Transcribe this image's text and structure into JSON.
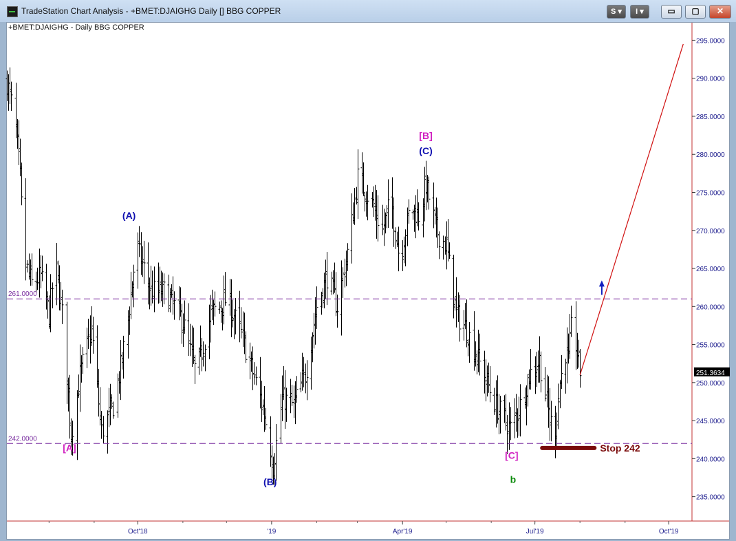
{
  "window": {
    "title": "TradeStation Chart Analysis - +BMET:DJAIGHG Daily [] BBG COPPER",
    "buttons": {
      "s_label": "S",
      "i_label": "I",
      "minimize": "▭",
      "maximize": "▢",
      "close": "✕"
    }
  },
  "colors": {
    "bars": "#000000",
    "level_line": "#7a2fa0",
    "projection": "#d01010",
    "stop_bar": "#7a0a0a",
    "label_blue": "#1010b0",
    "label_magenta": "#d020c0",
    "label_green": "#0a8a0a",
    "arrow": "#1020c0"
  },
  "chart_data": {
    "type": "ohlc",
    "symbol_label": "+BMET:DJAIGHG - Daily  BBG COPPER",
    "y_ticks": [
      "295.0000",
      "290.0000",
      "285.0000",
      "280.0000",
      "275.0000",
      "270.0000",
      "265.0000",
      "260.0000",
      "255.0000",
      "250.0000",
      "245.0000",
      "240.0000",
      "235.0000"
    ],
    "ylim": [
      231.8,
      297.3
    ],
    "x_ticks": [
      {
        "label": "Oct'18",
        "date": "2018-10-01"
      },
      {
        "label": "'19",
        "date": "2019-01-01"
      },
      {
        "label": "Apr'19",
        "date": "2019-04-01"
      },
      {
        "label": "Jul'19",
        "date": "2019-07-01"
      },
      {
        "label": "Oct'19",
        "date": "2019-10-01"
      }
    ],
    "xlim": [
      "2018-07-03",
      "2019-10-17"
    ],
    "last_price": "251.3634",
    "levels": [
      {
        "value": 261.0,
        "label": "261.0000"
      },
      {
        "value": 242.0,
        "label": "242.0000"
      }
    ],
    "projection": {
      "from": {
        "date": "2019-08-01",
        "value": 251.0
      },
      "to": {
        "date": "2019-10-11",
        "value": 294.5
      }
    },
    "up_arrow": {
      "date": "2019-08-16",
      "value": 262.8
    },
    "stop": {
      "from": "2019-07-06",
      "to": "2019-08-11",
      "value": 241.4,
      "label": "Stop 242"
    },
    "wave_labels": [
      {
        "text": "[A]",
        "date": "2018-08-15",
        "value": 241.0,
        "color": "magenta"
      },
      {
        "text": "(A)",
        "date": "2018-09-25",
        "value": 271.5,
        "color": "blue"
      },
      {
        "text": "(B)",
        "date": "2018-12-31",
        "value": 236.5,
        "color": "blue"
      },
      {
        "text": "[B]",
        "date": "2019-04-17",
        "value": 282.0,
        "color": "magenta"
      },
      {
        "text": "(C)",
        "date": "2019-04-17",
        "value": 280.0,
        "color": "blue"
      },
      {
        "text": "[C]",
        "date": "2019-06-15",
        "value": 240.0,
        "color": "magenta"
      },
      {
        "text": "b",
        "date": "2019-06-16",
        "value": 236.8,
        "color": "green"
      }
    ],
    "price_path": [
      [
        "2018-07-03",
        289.5
      ],
      [
        "2018-07-08",
        285.0
      ],
      [
        "2018-07-12",
        277.0
      ],
      [
        "2018-07-15",
        266.0
      ],
      [
        "2018-07-20",
        263.0
      ],
      [
        "2018-07-26",
        264.0
      ],
      [
        "2018-08-01",
        259.0
      ],
      [
        "2018-08-05",
        266.0
      ],
      [
        "2018-08-10",
        259.0
      ],
      [
        "2018-08-16",
        243.0
      ],
      [
        "2018-08-22",
        251.0
      ],
      [
        "2018-08-30",
        257.0
      ],
      [
        "2018-09-06",
        243.5
      ],
      [
        "2018-09-14",
        247.0
      ],
      [
        "2018-09-20",
        253.0
      ],
      [
        "2018-09-25",
        260.0
      ],
      [
        "2018-09-30",
        268.0
      ],
      [
        "2018-10-10",
        262.0
      ],
      [
        "2018-10-20",
        262.0
      ],
      [
        "2018-11-01",
        258.0
      ],
      [
        "2018-11-10",
        251.0
      ],
      [
        "2018-11-20",
        259.0
      ],
      [
        "2018-12-01",
        261.0
      ],
      [
        "2018-12-10",
        257.0
      ],
      [
        "2018-12-18",
        252.0
      ],
      [
        "2018-12-27",
        246.0
      ],
      [
        "2019-01-02",
        239.0
      ],
      [
        "2019-01-08",
        248.0
      ],
      [
        "2019-01-16",
        247.0
      ],
      [
        "2019-01-24",
        251.0
      ],
      [
        "2019-02-01",
        260.0
      ],
      [
        "2019-02-08",
        264.0
      ],
      [
        "2019-02-15",
        260.0
      ],
      [
        "2019-02-23",
        268.0
      ],
      [
        "2019-03-01",
        277.0
      ],
      [
        "2019-03-10",
        274.0
      ],
      [
        "2019-03-18",
        270.0
      ],
      [
        "2019-03-24",
        274.0
      ],
      [
        "2019-03-30",
        266.0
      ],
      [
        "2019-04-06",
        273.0
      ],
      [
        "2019-04-12",
        272.0
      ],
      [
        "2019-04-17",
        276.0
      ],
      [
        "2019-04-24",
        270.0
      ],
      [
        "2019-05-01",
        268.0
      ],
      [
        "2019-05-08",
        259.0
      ],
      [
        "2019-05-15",
        257.0
      ],
      [
        "2019-05-25",
        252.0
      ],
      [
        "2019-06-04",
        247.0
      ],
      [
        "2019-06-14",
        244.0
      ],
      [
        "2019-06-21",
        247.0
      ],
      [
        "2019-06-27",
        251.0
      ],
      [
        "2019-07-04",
        253.0
      ],
      [
        "2019-07-11",
        245.0
      ],
      [
        "2019-07-15",
        244.0
      ],
      [
        "2019-07-18",
        250.0
      ],
      [
        "2019-07-22",
        254.0
      ],
      [
        "2019-07-24",
        253.0
      ],
      [
        "2019-07-27",
        259.0
      ],
      [
        "2019-07-29",
        255.0
      ],
      [
        "2019-08-01",
        251.4
      ]
    ]
  }
}
